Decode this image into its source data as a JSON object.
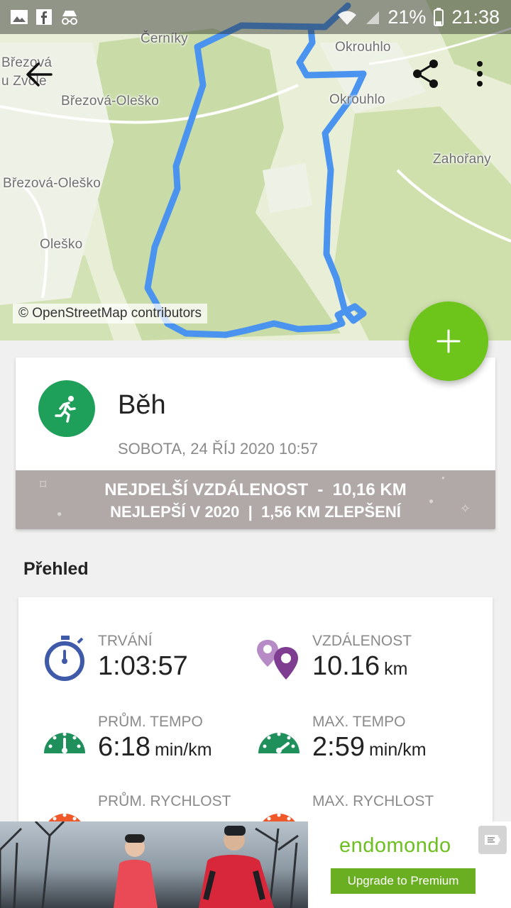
{
  "status_bar": {
    "battery": "21%",
    "time": "21:38"
  },
  "map": {
    "labels": [
      "Černíky",
      "Březová\nu Zvole",
      "Březová-Oleško",
      "Březová-Oleško",
      "Oleško",
      "Okrouhlo",
      "Okrouhlo",
      "Zahořany"
    ],
    "attribution": "© OpenStreetMap contributors",
    "route_color": "#4a94f0"
  },
  "workout": {
    "title": "Běh",
    "date": "SOBOTA, 24 ŘÍJ 2020 10:57",
    "record_line1": "NEJDELŠÍ VZDÁLENOST  -  10,16 KM",
    "record_line2": "NEJLEPŠÍ V 2020  |  1,56 KM ZLEPŠENÍ",
    "sport_icon": "running-icon",
    "accent": "#1fa05a"
  },
  "overview": {
    "title": "Přehled",
    "stats": [
      {
        "label": "TRVÁNÍ",
        "value": "1:03:57",
        "unit": "",
        "icon": "stopwatch-icon"
      },
      {
        "label": "VZDÁLENOST",
        "value": "10.16",
        "unit": "km",
        "icon": "location-pins-icon"
      },
      {
        "label": "PRŮM. TEMPO",
        "value": "6:18",
        "unit": "min/km",
        "icon": "speedometer-icon"
      },
      {
        "label": "MAX. TEMPO",
        "value": "2:59",
        "unit": "min/km",
        "icon": "speedometer-icon"
      },
      {
        "label": "PRŮM. RYCHLOST",
        "value": "",
        "unit": "",
        "icon": "speedometer-icon"
      },
      {
        "label": "MAX. RYCHLOST",
        "value": "",
        "unit": "",
        "icon": "speedometer-icon"
      }
    ]
  },
  "ad": {
    "brand": "endomondo",
    "cta": "Upgrade to Premium"
  }
}
